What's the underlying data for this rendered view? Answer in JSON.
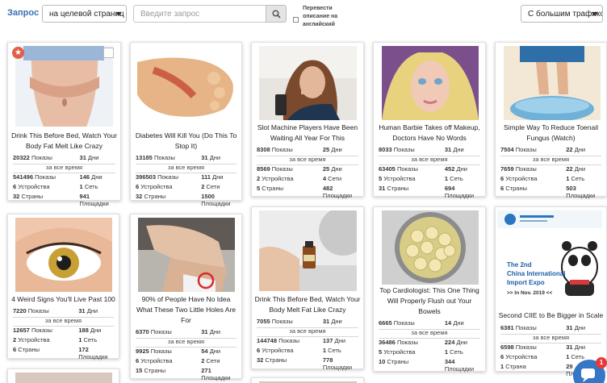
{
  "toolbar": {
    "query_label": "Запрос",
    "target_select": "на целевой страниц",
    "search_placeholder": "Введите запрос",
    "translate_label": "Перевести описание на английский",
    "traffic_select": "С большим трафиком"
  },
  "stat_labels": {
    "shows": "Показы",
    "days": "Дни",
    "all_time": "за все время",
    "devices": "Устройства",
    "networks": "Сеть",
    "networks_plural": "Сети",
    "countries": "Страны",
    "countries_plural": "Страна",
    "platforms": "Площадки"
  },
  "cards": [
    {
      "title": "Drink This Before Bed, Watch Your Body Fat Melt Like Crazy",
      "shows": "20322",
      "days": "31",
      "total_shows": "541496",
      "total_days": "146",
      "devices": "6",
      "networks": "1",
      "networks_label": "Сеть",
      "countries": "32",
      "countries_label": "Страны",
      "platforms": "941"
    },
    {
      "title": "Diabetes Will Kill You (Do This To Stop It)",
      "shows": "13185",
      "days": "31",
      "total_shows": "396503",
      "total_days": "111",
      "devices": "6",
      "networks": "2",
      "networks_label": "Сети",
      "countries": "32",
      "countries_label": "Страны",
      "platforms": "1500"
    },
    {
      "title": "Slot Machine Players Have Been Waiting All Year For This",
      "shows": "8308",
      "days": "25",
      "total_shows": "8569",
      "total_days": "25",
      "devices": "2",
      "networks": "4",
      "networks_label": "Сети",
      "countries": "5",
      "countries_label": "Страны",
      "platforms": "482"
    },
    {
      "title": "Human Barbie Takes off Makeup, Doctors Have No Words",
      "shows": "8033",
      "days": "31",
      "total_shows": "63405",
      "total_days": "452",
      "devices": "5",
      "networks": "1",
      "networks_label": "Сеть",
      "countries": "31",
      "countries_label": "Страны",
      "platforms": "694"
    },
    {
      "title": "Simple Way To Reduce Toenail Fungus (Watch)",
      "shows": "7504",
      "days": "22",
      "total_shows": "7659",
      "total_days": "22",
      "devices": "6",
      "networks": "1",
      "networks_label": "Сеть",
      "countries": "6",
      "countries_label": "Страны",
      "platforms": "503"
    },
    {
      "title": "4 Weird Signs You'll Live Past 100",
      "shows": "7220",
      "days": "31",
      "total_shows": "12657",
      "total_days": "188",
      "devices": "2",
      "networks": "1",
      "networks_label": "Сеть",
      "countries": "6",
      "countries_label": "Страны",
      "platforms": "172"
    },
    {
      "title": "90% of People Have No Idea What These Two Little Holes Are For",
      "shows": "6370",
      "days": "31",
      "total_shows": "9925",
      "total_days": "54",
      "devices": "6",
      "networks": "2",
      "networks_label": "Сети",
      "countries": "15",
      "countries_label": "Страны",
      "platforms": "271"
    },
    {
      "title": "Drink This Before Bed, Watch Your Body Melt Fat Like Crazy",
      "shows": "7055",
      "days": "31",
      "total_shows": "144748",
      "total_days": "137",
      "devices": "6",
      "networks": "1",
      "networks_label": "Сеть",
      "countries": "32",
      "countries_label": "Страны",
      "platforms": "778"
    },
    {
      "title": "Top Cardiologist: This One Thing Will Properly Flush out Your Bowels",
      "shows": "6665",
      "days": "14",
      "total_shows": "36486",
      "total_days": "224",
      "devices": "5",
      "networks": "1",
      "networks_label": "Сеть",
      "countries": "10",
      "countries_label": "Страны",
      "platforms": "344"
    },
    {
      "title": "Second CIIE to Be Bigger in Scale",
      "shows": "6381",
      "days": "31",
      "total_shows": "6598",
      "total_days": "31",
      "devices": "6",
      "networks": "1",
      "networks_label": "Сеть",
      "countries": "1",
      "countries_label": "Страна",
      "platforms": "29"
    }
  ],
  "ciie_banner": {
    "line1": "The 2nd",
    "line2": "China International",
    "line3": "Import Expo",
    "line4": ">> In Nov. 2019 <<"
  },
  "chat": {
    "badge": "1"
  }
}
